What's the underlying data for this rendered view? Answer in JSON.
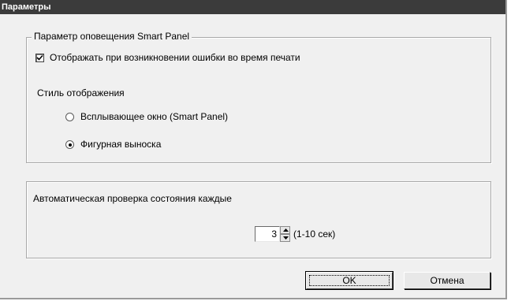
{
  "window": {
    "title": "Параметры"
  },
  "notify_group": {
    "legend": "Параметр оповещения Smart Panel",
    "show_on_error": {
      "label": "Отображать при возникновении ошибки во время печати",
      "checked": true
    },
    "style_label": "Стиль отображения",
    "options": [
      {
        "label": "Всплывающее окно (Smart Panel)",
        "selected": false
      },
      {
        "label": "Фигурная выноска",
        "selected": true
      }
    ]
  },
  "status_group": {
    "label": "Автоматическая проверка состояния каждые",
    "interval_value": "3",
    "range_hint": "(1-10 сек)"
  },
  "buttons": {
    "ok": "OK",
    "cancel": "Отмена"
  }
}
